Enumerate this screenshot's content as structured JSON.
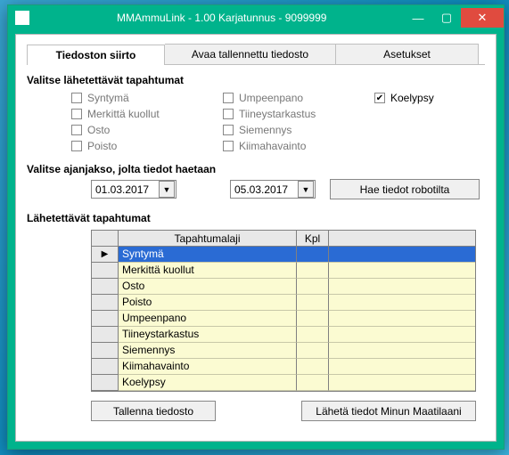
{
  "titlebar": {
    "text": "MMAmmuLink - 1.00    Karjatunnus - 9099999"
  },
  "tabs": {
    "t1": "Tiedoston siirto",
    "t2": "Avaa tallennettu tiedosto",
    "t3": "Asetukset"
  },
  "sections": {
    "select_events": "Valitse lähetettävät tapahtumat",
    "select_period": "Valitse ajanjakso, jolta tiedot haetaan",
    "events_to_send": "Lähetettävät tapahtumat"
  },
  "checkboxes": {
    "col1": [
      {
        "label": "Syntymä",
        "checked": false
      },
      {
        "label": "Merkittä kuollut",
        "checked": false
      },
      {
        "label": "Osto",
        "checked": false
      },
      {
        "label": "Poisto",
        "checked": false
      }
    ],
    "col2": [
      {
        "label": "Umpeenpano",
        "checked": false
      },
      {
        "label": "Tiineystarkastus",
        "checked": false
      },
      {
        "label": "Siemennys",
        "checked": false
      },
      {
        "label": "Kiimahavainto",
        "checked": false
      }
    ],
    "col3": [
      {
        "label": "Koelypsy",
        "checked": true
      }
    ]
  },
  "dates": {
    "from": "01.03.2017",
    "to": "05.03.2017"
  },
  "buttons": {
    "fetch": "Hae tiedot robotilta",
    "save": "Tallenna tiedosto",
    "send": "Lähetä tiedot Minun Maatilaani"
  },
  "grid": {
    "h1": "Tapahtumalaji",
    "h2": "Kpl",
    "rows": [
      "Syntymä",
      "Merkittä kuollut",
      "Osto",
      "Poisto",
      "Umpeenpano",
      "Tiineystarkastus",
      "Siemennys",
      "Kiimahavainto",
      "Koelypsy"
    ]
  }
}
